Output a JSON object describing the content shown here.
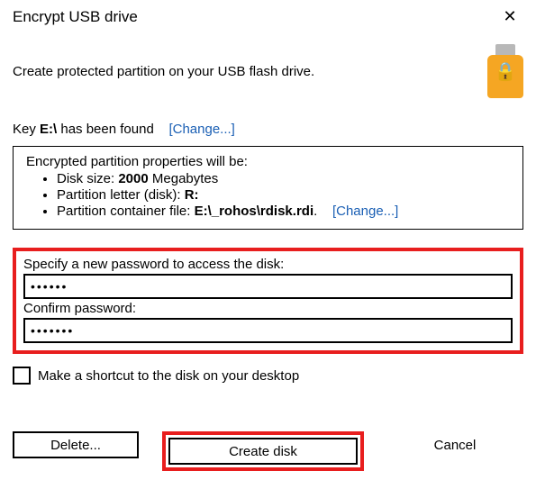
{
  "title": "Encrypt USB drive",
  "intro": "Create protected partition on your USB flash drive.",
  "key_row": {
    "prefix": "Key ",
    "drive": "E:\\",
    "suffix": " has been found",
    "change": "[Change...]"
  },
  "props": {
    "header": "Encrypted partition properties will be:",
    "size_label": "Disk size: ",
    "size_value": "2000",
    "size_unit": " Megabytes",
    "letter_label": "Partition letter (disk): ",
    "letter_value": "R:",
    "container_label": "Partition container file: ",
    "container_value": "E:\\_rohos\\rdisk.rdi",
    "container_period": ".",
    "change": "[Change...]"
  },
  "pw": {
    "label1": "Specify a new password to access the disk:",
    "value1": "••••••",
    "label2": "Confirm password:",
    "value2": "•••••••"
  },
  "shortcut_label": "Make a shortcut to the disk on your desktop",
  "buttons": {
    "delete": "Delete...",
    "create": "Create disk",
    "cancel": "Cancel"
  }
}
